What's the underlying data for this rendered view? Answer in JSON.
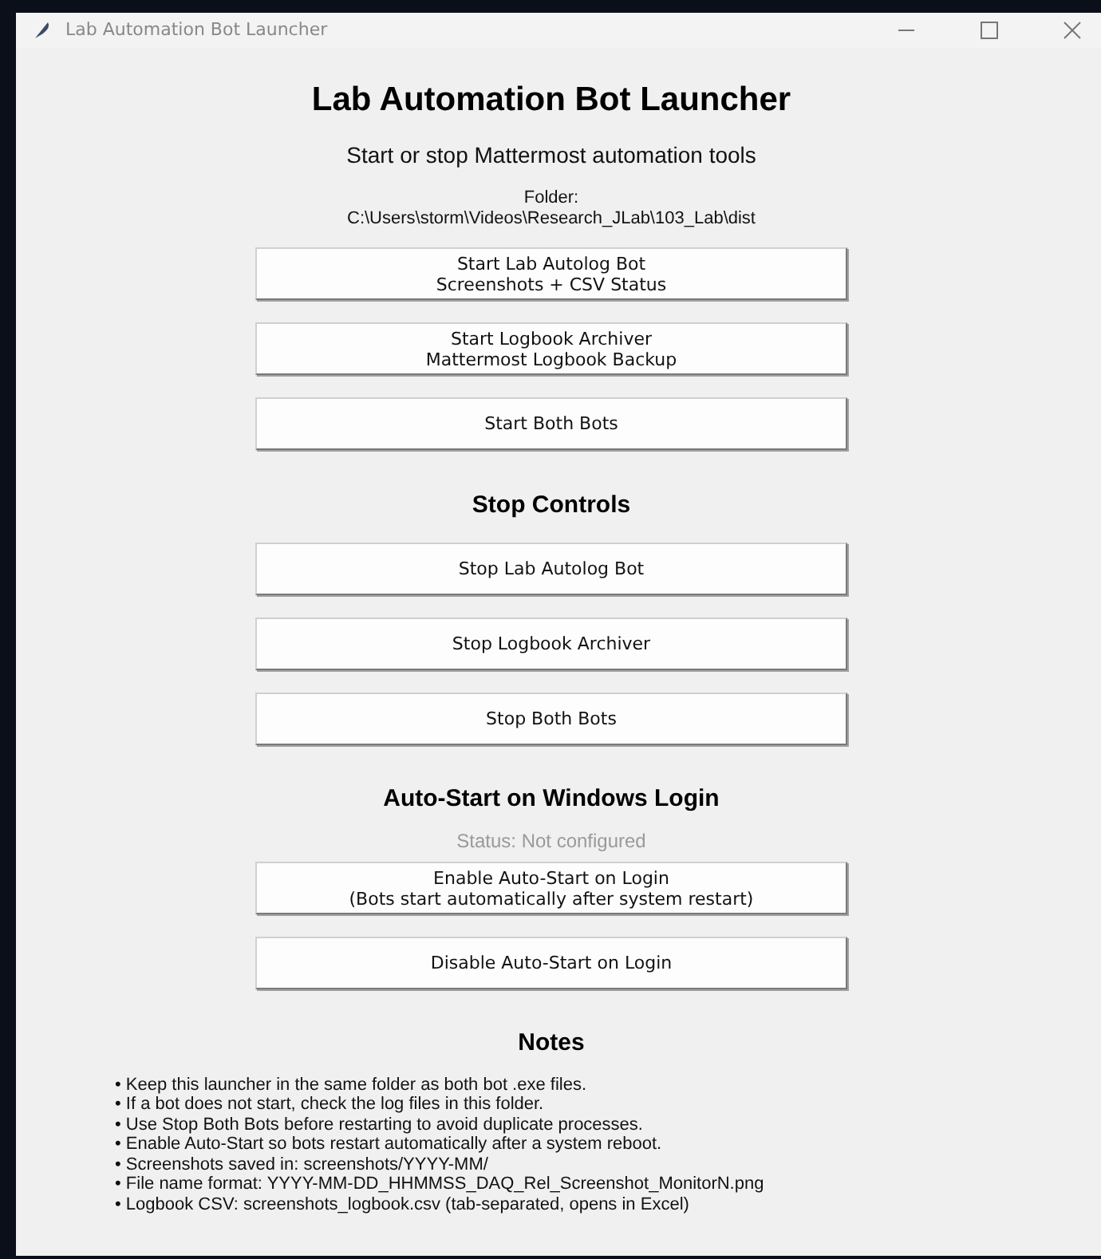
{
  "window": {
    "title": "Lab Automation Bot Launcher"
  },
  "header": {
    "title": "Lab Automation Bot Launcher",
    "subtitle": "Start or stop Mattermost automation tools",
    "folder_label": "Folder:",
    "folder_path": "C:\\Users\\storm\\Videos\\Research_JLab\\103_Lab\\dist"
  },
  "start_buttons": [
    {
      "label": "Start Lab Autolog Bot\nScreenshots + CSV Status"
    },
    {
      "label": "Start Logbook Archiver\nMattermost Logbook Backup"
    },
    {
      "label": "Start Both Bots"
    }
  ],
  "stop_section": {
    "heading": "Stop Controls",
    "buttons": [
      {
        "label": "Stop Lab Autolog Bot"
      },
      {
        "label": "Stop Logbook Archiver"
      },
      {
        "label": "Stop Both Bots"
      }
    ]
  },
  "autostart_section": {
    "heading": "Auto-Start on Windows Login",
    "status": "Status: Not configured",
    "buttons": [
      {
        "label": "Enable Auto-Start on Login\n(Bots start automatically after system restart)"
      },
      {
        "label": "Disable Auto-Start on Login"
      }
    ]
  },
  "notes": {
    "heading": "Notes",
    "items": [
      "• Keep this launcher in the same folder as both bot .exe files.",
      "• If a bot does not start, check the log files in this folder.",
      "• Use Stop Both Bots before restarting to avoid duplicate processes.",
      "• Enable Auto-Start so bots restart automatically after a system reboot.",
      "• Screenshots saved in: screenshots/YYYY-MM/",
      "• File name format: YYYY-MM-DD_HHMMSS_DAQ_Rel_Screenshot_MonitorN.png",
      "• Logbook CSV: screenshots_logbook.csv (tab-separated, opens in Excel)"
    ]
  }
}
